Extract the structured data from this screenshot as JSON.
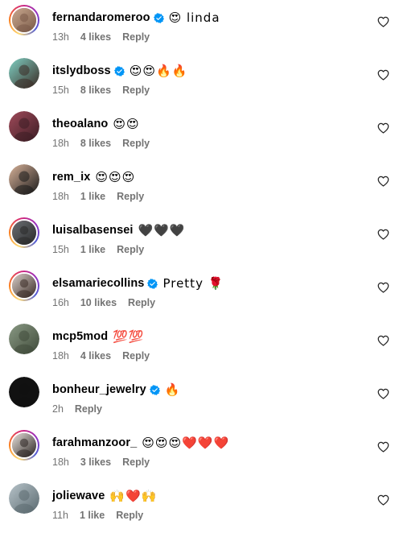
{
  "comments": [
    {
      "username": "fernandaromeroo",
      "verified": true,
      "text": "😍 linda",
      "time": "13h",
      "likes": "4 likes",
      "reply": "Reply",
      "avatar_ring": true,
      "avatar_colors": [
        "#c9a88f",
        "#7a5a48"
      ]
    },
    {
      "username": "itslydboss",
      "verified": true,
      "text": "😍😍🔥🔥",
      "time": "15h",
      "likes": "8 likes",
      "reply": "Reply",
      "avatar_ring": false,
      "avatar_colors": [
        "#7fd1c4",
        "#3a2a24"
      ]
    },
    {
      "username": "theoalano",
      "verified": false,
      "text": "😍😍",
      "time": "18h",
      "likes": "8 likes",
      "reply": "Reply",
      "avatar_ring": false,
      "avatar_colors": [
        "#a04a5a",
        "#3c1d24"
      ]
    },
    {
      "username": "rem_ix",
      "verified": false,
      "text": "😍😍😍",
      "time": "18h",
      "likes": "1 like",
      "reply": "Reply",
      "avatar_ring": false,
      "avatar_colors": [
        "#d9b39a",
        "#1a1a1a"
      ]
    },
    {
      "username": "luisalbasensei",
      "verified": false,
      "text": "🖤🖤🖤",
      "time": "15h",
      "likes": "1 like",
      "reply": "Reply",
      "avatar_ring": true,
      "avatar_colors": [
        "#6b6f74",
        "#2a2a2a"
      ]
    },
    {
      "username": "elsamariecollins",
      "verified": true,
      "text": "Pretty 🌹",
      "time": "16h",
      "likes": "10 likes",
      "reply": "Reply",
      "avatar_ring": true,
      "avatar_colors": [
        "#d8cfc9",
        "#3b2b26"
      ]
    },
    {
      "username": "mcp5mod",
      "verified": false,
      "text": "💯💯",
      "time": "18h",
      "likes": "4 likes",
      "reply": "Reply",
      "avatar_ring": false,
      "avatar_colors": [
        "#8a9a84",
        "#3f4a3a"
      ]
    },
    {
      "username": "bonheur_jewelry",
      "verified": true,
      "text": "🔥",
      "time": "2h",
      "likes": "",
      "reply": "Reply",
      "avatar_ring": false,
      "avatar_colors": [
        "#111111",
        "#111111"
      ]
    },
    {
      "username": "farahmanzoor_",
      "verified": false,
      "text": "😍😍😍❤️❤️❤️",
      "time": "18h",
      "likes": "3 likes",
      "reply": "Reply",
      "avatar_ring": true,
      "avatar_colors": [
        "#e7e2dc",
        "#2b2422"
      ]
    },
    {
      "username": "joliewave",
      "verified": false,
      "text": "🙌❤️🙌",
      "time": "11h",
      "likes": "1 like",
      "reply": "Reply",
      "avatar_ring": false,
      "avatar_colors": [
        "#b7c3c9",
        "#5b6a70"
      ]
    }
  ],
  "colors": {
    "verified": "#0095f6",
    "meta_text": "#737373",
    "heart_stroke": "#262626"
  },
  "icons": {
    "like": "heart-outline-icon",
    "verified": "verified-badge-icon"
  }
}
